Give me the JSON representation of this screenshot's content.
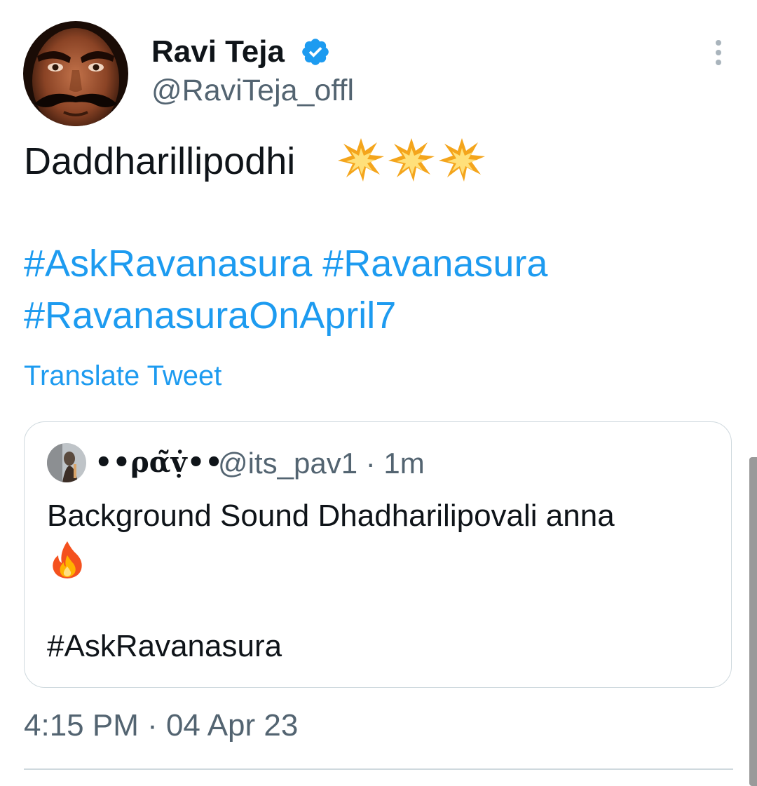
{
  "author": {
    "name": "Ravi Teja",
    "handle": "@RaviTeja_offl",
    "avatar_icon": "author-portrait",
    "verified_icon": "verified-badge-icon",
    "verified_color": "#1d9bf0"
  },
  "tweet": {
    "text": "Daddharillipodhi",
    "emoji_icons": [
      "collision-icon",
      "collision-icon",
      "collision-icon"
    ],
    "hashtag_lines": [
      [
        "#AskRavanasura",
        "#Ravanasura"
      ],
      [
        "#RavanasuraOnApril7"
      ]
    ],
    "translate_label": "Translate Tweet",
    "timestamp": "4:15 PM · 04 Apr 23"
  },
  "quoted_tweet": {
    "author_name": "••ρα̃ṿ̇••",
    "handle": "@its_pav1",
    "time": "1m",
    "text_line1": "Background Sound Dhadharilipovali anna",
    "emoji_icon": "fire-icon",
    "hashtag": "#AskRavanasura"
  },
  "colors": {
    "link": "#1d9bf0",
    "primary_text": "#0f1419",
    "secondary_text": "#536471",
    "border": "#cfd9de"
  }
}
